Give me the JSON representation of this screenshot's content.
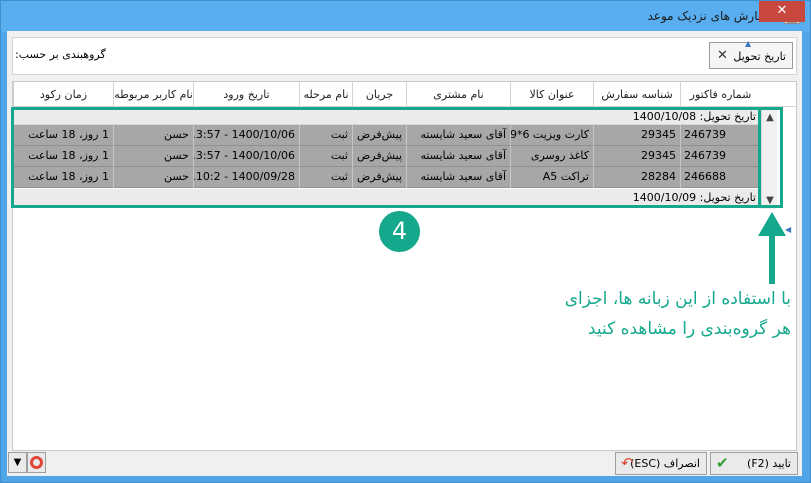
{
  "window": {
    "title": "سفارش های نزدیک موعد",
    "close_glyph": "✕"
  },
  "grouping": {
    "label": "گروهبندی بر حسب:",
    "chip_label": "تاریخ تحویل",
    "chip_remove_glyph": "✕",
    "chip_arrow_glyph": "▲"
  },
  "columns": [
    {
      "key": "invoice",
      "label": "شماره فاکتور"
    },
    {
      "key": "order_id",
      "label": "شناسه سفارش"
    },
    {
      "key": "product",
      "label": "عنوان کالا"
    },
    {
      "key": "customer",
      "label": "نام مشتری"
    },
    {
      "key": "flow",
      "label": "جریان"
    },
    {
      "key": "stage",
      "label": "نام مرحله"
    },
    {
      "key": "entry_date",
      "label": "تاریخ ورود"
    },
    {
      "key": "user",
      "label": "نام کاربر مربوطه"
    },
    {
      "key": "idle_time",
      "label": "زمان رکود"
    }
  ],
  "groups": [
    {
      "label": "تاریخ تحویل: 1400/10/08",
      "rows": [
        {
          "invoice": "246739",
          "order_id": "29345",
          "product": "کارت ویزیت 6*9",
          "customer": "آقای سعید شایسته",
          "flow": "پیش‌فرض",
          "stage": "ثبت",
          "entry_date": "1400/10/06 - 3:57...",
          "user": "حسن",
          "idle_time": "1 روز، 18 ساعت"
        },
        {
          "invoice": "246739",
          "order_id": "29345",
          "product": "کاغذ روسری",
          "customer": "آقای سعید شایسته",
          "flow": "پیش‌فرض",
          "stage": "ثبت",
          "entry_date": "1400/10/06 - 3:57...",
          "user": "حسن",
          "idle_time": "1 روز، 18 ساعت"
        },
        {
          "invoice": "246688",
          "order_id": "28284",
          "product": "تراکت A5",
          "customer": "آقای سعید شایسته",
          "flow": "پیش‌فرض",
          "stage": "ثبت",
          "entry_date": "1400/09/28 - 10:2...",
          "user": "حسن",
          "idle_time": "1 روز، 18 ساعت"
        }
      ]
    },
    {
      "label": "تاریخ تحویل: 1400/10/09",
      "rows": []
    }
  ],
  "annotation": {
    "badge": "4",
    "caption_line1": "با استفاده از این زبانه ها، اجزای",
    "caption_line2": "هر گروه‌بندی را مشاهده کنید"
  },
  "footer": {
    "ok_label": "تایید (F2)",
    "cancel_label": "انصراف (ESC)",
    "ok_icon": "check-icon",
    "cancel_icon": "undo-arrow-icon"
  },
  "colors": {
    "accent": "#15a88d",
    "selected_row": "#a7a7a7",
    "titlebar": "#59aef0"
  }
}
